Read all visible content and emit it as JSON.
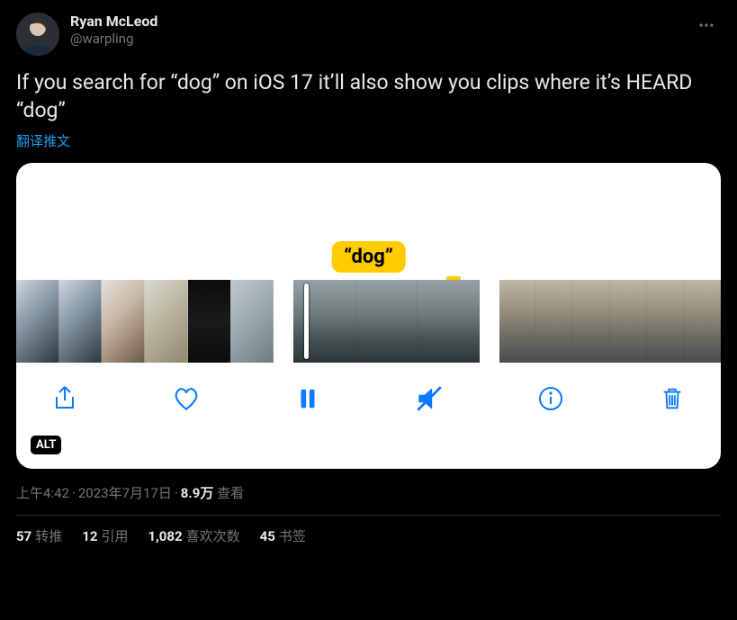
{
  "author": {
    "display_name": "Ryan McLeod",
    "handle": "@warpling"
  },
  "text": "If you search for “dog” on iOS 17 it’ll also show you clips where it’s HEARD “dog”",
  "translate_label": "翻译推文",
  "media": {
    "search_tag": "“dog”",
    "alt_badge": "ALT",
    "toolbar": {
      "share": "share",
      "like": "like",
      "pause": "pause",
      "mute": "mute",
      "info": "info",
      "delete": "delete"
    }
  },
  "meta": {
    "time": "上午4:42",
    "date": "2023年7月17日",
    "views_count": "8.9万",
    "views_label": "查看"
  },
  "stats": {
    "retweets_count": "57",
    "retweets_label": "转推",
    "quotes_count": "12",
    "quotes_label": "引用",
    "likes_count": "1,082",
    "likes_label": "喜欢次数",
    "bookmarks_count": "45",
    "bookmarks_label": "书签"
  }
}
